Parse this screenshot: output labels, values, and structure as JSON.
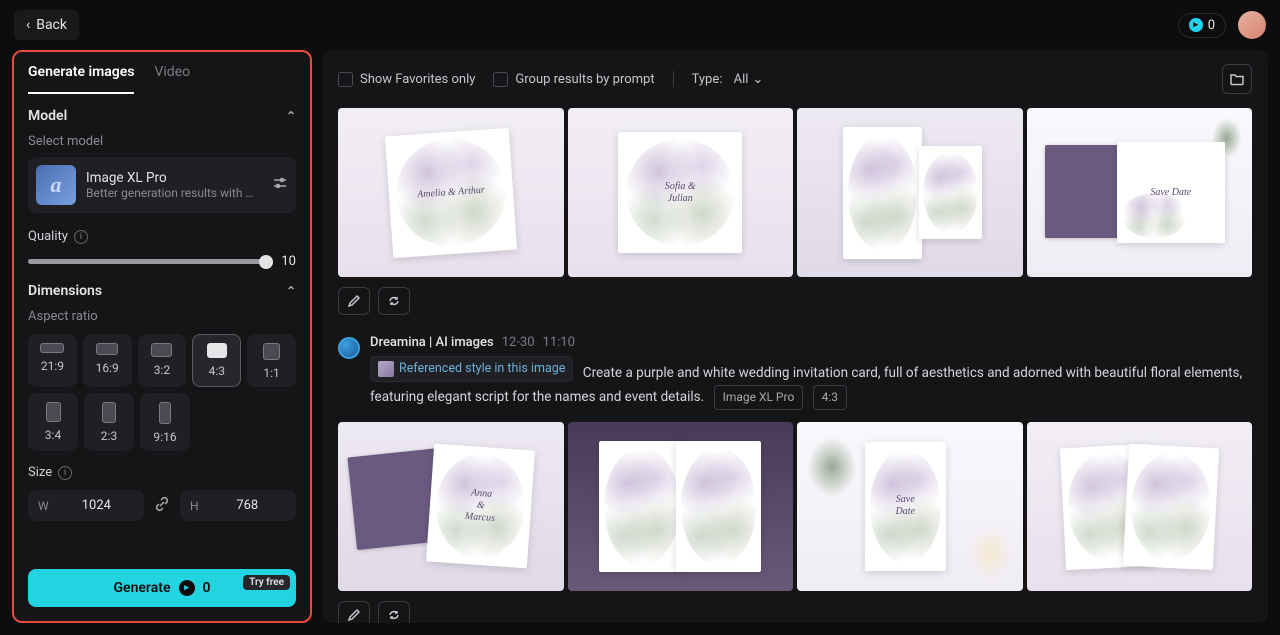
{
  "topbar": {
    "back": "Back",
    "credits": "0"
  },
  "tabs": {
    "generate": "Generate images",
    "video": "Video"
  },
  "model_section": {
    "title": "Model",
    "subtitle": "Select model",
    "name": "Image XL Pro",
    "desc": "Better generation results with profe..."
  },
  "quality": {
    "label": "Quality",
    "value": "10"
  },
  "dimensions": {
    "title": "Dimensions",
    "aspect_label": "Aspect ratio",
    "ratios": [
      "21:9",
      "16:9",
      "3:2",
      "4:3",
      "1:1"
    ],
    "ratios2": [
      "3:4",
      "2:3",
      "9:16"
    ],
    "size_label": "Size",
    "w_label": "W",
    "h_label": "H",
    "w": "1024",
    "h": "768"
  },
  "generate": {
    "label": "Generate",
    "cost": "0",
    "try_free": "Try free"
  },
  "toolbar": {
    "favorites": "Show Favorites only",
    "group": "Group results by prompt",
    "type_label": "Type:",
    "type_value": "All"
  },
  "generation": {
    "author": "Dreamina | AI images",
    "date": "12-30",
    "time": "11:10",
    "ref_label": "Referenced style in this image",
    "prompt": "Create a purple and white wedding invitation card, full of aesthetics and adorned with beautiful floral elements, featuring elegant script for the names and event details.",
    "tag_model": "Image XL Pro",
    "tag_ratio": "4:3"
  }
}
